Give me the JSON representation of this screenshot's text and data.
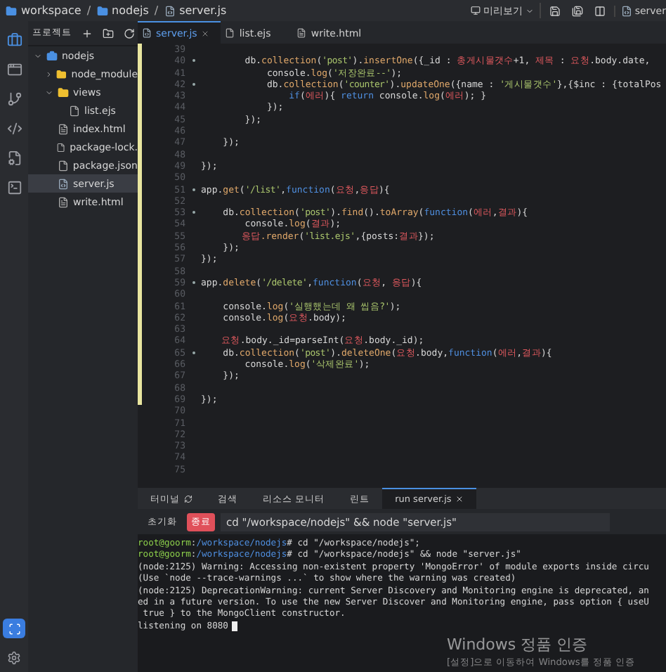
{
  "breadcrumb": [
    {
      "kind": "folder",
      "label": "workspace"
    },
    {
      "kind": "sep",
      "label": "/"
    },
    {
      "kind": "folder",
      "label": "nodejs"
    },
    {
      "kind": "sep",
      "label": "/"
    },
    {
      "kind": "file",
      "label": "server.js"
    }
  ],
  "toolbar": {
    "preview": "미리보기",
    "open_file": "server"
  },
  "activity_bar": [
    {
      "kind": "project",
      "selected": true
    },
    {
      "kind": "preview",
      "selected": false
    },
    {
      "kind": "git",
      "selected": false
    },
    {
      "kind": "code",
      "selected": false
    },
    {
      "kind": "config",
      "selected": false
    },
    {
      "kind": "vs",
      "selected": false
    }
  ],
  "file_tree": {
    "header": "프로젝트",
    "items": [
      {
        "label": "nodejs",
        "kind": "project",
        "expanded": true,
        "selected": false,
        "children": [
          {
            "label": "node_module",
            "kind": "folder",
            "expanded": false,
            "selected": false
          },
          {
            "label": "views",
            "kind": "folder",
            "expanded": true,
            "selected": false,
            "children": [
              {
                "label": "list.ejs",
                "kind": "file",
                "selected": false
              }
            ]
          },
          {
            "label": "index.html",
            "kind": "html",
            "selected": false
          },
          {
            "label": "package-lock.",
            "kind": "file",
            "selected": false
          },
          {
            "label": "package.json",
            "kind": "file",
            "selected": false
          },
          {
            "label": "server.js",
            "kind": "js",
            "selected": true
          },
          {
            "label": "write.html",
            "kind": "html",
            "selected": false
          }
        ]
      }
    ]
  },
  "editor": {
    "tabs": [
      {
        "label": "server.js",
        "kind": "js",
        "selected": true,
        "closable": true
      },
      {
        "label": "list.ejs",
        "kind": "file",
        "selected": false,
        "closable": false
      },
      {
        "label": "write.html",
        "kind": "html",
        "selected": false,
        "closable": false
      }
    ],
    "lines": [
      {
        "number": "39",
        "changed": true,
        "foldable": false
      },
      {
        "number": "40",
        "changed": true,
        "foldable": true,
        "code": [
          {
            "text": "        db.",
            "kind": "plain"
          },
          {
            "text": "collection",
            "kind": "method"
          },
          {
            "text": "(",
            "kind": "plain"
          },
          {
            "text": "'post'",
            "kind": "string"
          },
          {
            "text": ").",
            "kind": "plain"
          },
          {
            "text": "insertOne",
            "kind": "method"
          },
          {
            "text": "({_id : ",
            "kind": "plain"
          },
          {
            "text": "총게시물갯수",
            "kind": "hangul"
          },
          {
            "text": "+1, ",
            "kind": "plain"
          },
          {
            "text": "제목",
            "kind": "hangul"
          },
          {
            "text": " : ",
            "kind": "plain"
          },
          {
            "text": "요청",
            "kind": "hangul"
          },
          {
            "text": ".body.date,",
            "kind": "plain"
          }
        ]
      },
      {
        "number": "41",
        "changed": true,
        "foldable": false,
        "code": [
          {
            "text": "            console.",
            "kind": "plain"
          },
          {
            "text": "log",
            "kind": "method"
          },
          {
            "text": "(",
            "kind": "plain"
          },
          {
            "text": "'저장완료--'",
            "kind": "string"
          },
          {
            "text": ");",
            "kind": "plain"
          }
        ]
      },
      {
        "number": "42",
        "changed": true,
        "foldable": true,
        "code": [
          {
            "text": "            db.",
            "kind": "plain"
          },
          {
            "text": "collection",
            "kind": "method"
          },
          {
            "text": "(",
            "kind": "plain"
          },
          {
            "text": "'counter'",
            "kind": "string"
          },
          {
            "text": ").",
            "kind": "plain"
          },
          {
            "text": "updateOne",
            "kind": "method"
          },
          {
            "text": "({name : ",
            "kind": "plain"
          },
          {
            "text": "'게시물갯수'",
            "kind": "string"
          },
          {
            "text": "},{$inc : {totalPos",
            "kind": "plain"
          }
        ]
      },
      {
        "number": "43",
        "changed": true,
        "foldable": false,
        "code": [
          {
            "text": "                if",
            "kind": "keyword"
          },
          {
            "text": "(",
            "kind": "plain"
          },
          {
            "text": "에러",
            "kind": "hangul"
          },
          {
            "text": "){ ",
            "kind": "plain"
          },
          {
            "text": "return",
            "kind": "keyword"
          },
          {
            "text": " console.",
            "kind": "plain"
          },
          {
            "text": "log",
            "kind": "method"
          },
          {
            "text": "(",
            "kind": "plain"
          },
          {
            "text": "에러",
            "kind": "hangul"
          },
          {
            "text": "); }",
            "kind": "plain"
          }
        ]
      },
      {
        "number": "44",
        "changed": true,
        "foldable": false,
        "code": [
          {
            "text": "            });",
            "kind": "plain"
          }
        ]
      },
      {
        "number": "45",
        "changed": true,
        "foldable": false,
        "code": [
          {
            "text": "        });",
            "kind": "plain"
          }
        ]
      },
      {
        "number": "46",
        "changed": true,
        "foldable": false
      },
      {
        "number": "47",
        "changed": true,
        "foldable": false,
        "code": [
          {
            "text": "    });",
            "kind": "plain"
          }
        ]
      },
      {
        "number": "48",
        "changed": true,
        "foldable": false
      },
      {
        "number": "49",
        "changed": true,
        "foldable": false,
        "code": [
          {
            "text": "});",
            "kind": "plain"
          }
        ]
      },
      {
        "number": "50",
        "changed": true,
        "foldable": false
      },
      {
        "number": "51",
        "changed": true,
        "foldable": true,
        "code": [
          {
            "text": "app.",
            "kind": "plain"
          },
          {
            "text": "get",
            "kind": "method"
          },
          {
            "text": "(",
            "kind": "plain"
          },
          {
            "text": "'/list'",
            "kind": "string"
          },
          {
            "text": ",",
            "kind": "plain"
          },
          {
            "text": "function",
            "kind": "keyword"
          },
          {
            "text": "(",
            "kind": "plain"
          },
          {
            "text": "요청",
            "kind": "hangul"
          },
          {
            "text": ",",
            "kind": "plain"
          },
          {
            "text": "응답",
            "kind": "hangul"
          },
          {
            "text": "){",
            "kind": "plain"
          }
        ]
      },
      {
        "number": "52",
        "changed": true,
        "foldable": false
      },
      {
        "number": "53",
        "changed": true,
        "foldable": true,
        "code": [
          {
            "text": "    db.",
            "kind": "plain"
          },
          {
            "text": "collection",
            "kind": "method"
          },
          {
            "text": "(",
            "kind": "plain"
          },
          {
            "text": "'post'",
            "kind": "string"
          },
          {
            "text": ").",
            "kind": "plain"
          },
          {
            "text": "find",
            "kind": "method"
          },
          {
            "text": "().",
            "kind": "plain"
          },
          {
            "text": "toArray",
            "kind": "method"
          },
          {
            "text": "(",
            "kind": "plain"
          },
          {
            "text": "function",
            "kind": "keyword"
          },
          {
            "text": "(",
            "kind": "plain"
          },
          {
            "text": "에러",
            "kind": "hangul"
          },
          {
            "text": ",",
            "kind": "plain"
          },
          {
            "text": "결과",
            "kind": "hangul"
          },
          {
            "text": "){",
            "kind": "plain"
          }
        ]
      },
      {
        "number": "54",
        "changed": true,
        "foldable": false,
        "code": [
          {
            "text": "        console.",
            "kind": "plain"
          },
          {
            "text": "log",
            "kind": "method"
          },
          {
            "text": "(",
            "kind": "plain"
          },
          {
            "text": "결과",
            "kind": "hangul"
          },
          {
            "text": ");",
            "kind": "plain"
          }
        ]
      },
      {
        "number": "55",
        "changed": true,
        "foldable": false,
        "code": [
          {
            "text": "        응답",
            "kind": "hangul"
          },
          {
            "text": ".render",
            "kind": "method"
          },
          {
            "text": "(",
            "kind": "plain"
          },
          {
            "text": "'list.ejs'",
            "kind": "string"
          },
          {
            "text": ",{posts:",
            "kind": "plain"
          },
          {
            "text": "결과",
            "kind": "hangul"
          },
          {
            "text": "});",
            "kind": "plain"
          }
        ]
      },
      {
        "number": "56",
        "changed": true,
        "foldable": false,
        "code": [
          {
            "text": "    });",
            "kind": "plain"
          }
        ]
      },
      {
        "number": "57",
        "changed": true,
        "foldable": false,
        "code": [
          {
            "text": "});",
            "kind": "plain"
          }
        ]
      },
      {
        "number": "58",
        "changed": true,
        "foldable": false
      },
      {
        "number": "59",
        "changed": true,
        "foldable": true,
        "code": [
          {
            "text": "app.",
            "kind": "plain"
          },
          {
            "text": "delete",
            "kind": "method"
          },
          {
            "text": "(",
            "kind": "plain"
          },
          {
            "text": "'/delete'",
            "kind": "string"
          },
          {
            "text": ",",
            "kind": "plain"
          },
          {
            "text": "function",
            "kind": "keyword"
          },
          {
            "text": "(",
            "kind": "plain"
          },
          {
            "text": "요청",
            "kind": "hangul"
          },
          {
            "text": ", ",
            "kind": "plain"
          },
          {
            "text": "응답",
            "kind": "hangul"
          },
          {
            "text": "){",
            "kind": "plain"
          }
        ]
      },
      {
        "number": "60",
        "changed": true,
        "foldable": false
      },
      {
        "number": "61",
        "changed": true,
        "foldable": false,
        "code": [
          {
            "text": "    console.",
            "kind": "plain"
          },
          {
            "text": "log",
            "kind": "method"
          },
          {
            "text": "(",
            "kind": "plain"
          },
          {
            "text": "'실행했는데 왜 씹음?'",
            "kind": "string"
          },
          {
            "text": ");",
            "kind": "plain"
          }
        ]
      },
      {
        "number": "62",
        "changed": true,
        "foldable": false,
        "code": [
          {
            "text": "    console.",
            "kind": "plain"
          },
          {
            "text": "log",
            "kind": "method"
          },
          {
            "text": "(",
            "kind": "plain"
          },
          {
            "text": "요청",
            "kind": "hangul"
          },
          {
            "text": ".body);",
            "kind": "plain"
          }
        ]
      },
      {
        "number": "63",
        "changed": true,
        "foldable": false
      },
      {
        "number": "64",
        "changed": true,
        "foldable": false,
        "code": [
          {
            "text": "    요청",
            "kind": "hangul"
          },
          {
            "text": ".body._id=parseInt(",
            "kind": "plain"
          },
          {
            "text": "요청",
            "kind": "hangul"
          },
          {
            "text": ".body._id);",
            "kind": "plain"
          }
        ]
      },
      {
        "number": "65",
        "changed": true,
        "foldable": true,
        "code": [
          {
            "text": "    db.",
            "kind": "plain"
          },
          {
            "text": "collection",
            "kind": "method"
          },
          {
            "text": "(",
            "kind": "plain"
          },
          {
            "text": "'post'",
            "kind": "string"
          },
          {
            "text": ").",
            "kind": "plain"
          },
          {
            "text": "deleteOne",
            "kind": "method"
          },
          {
            "text": "(",
            "kind": "plain"
          },
          {
            "text": "요청",
            "kind": "hangul"
          },
          {
            "text": ".body,",
            "kind": "plain"
          },
          {
            "text": "function",
            "kind": "keyword"
          },
          {
            "text": "(",
            "kind": "plain"
          },
          {
            "text": "에러",
            "kind": "hangul"
          },
          {
            "text": ",",
            "kind": "plain"
          },
          {
            "text": "결과",
            "kind": "hangul"
          },
          {
            "text": "){",
            "kind": "plain"
          }
        ]
      },
      {
        "number": "66",
        "changed": true,
        "foldable": false,
        "code": [
          {
            "text": "        console.",
            "kind": "plain"
          },
          {
            "text": "log",
            "kind": "method"
          },
          {
            "text": "(",
            "kind": "plain"
          },
          {
            "text": "'삭제완료'",
            "kind": "string"
          },
          {
            "text": ");",
            "kind": "plain"
          }
        ]
      },
      {
        "number": "67",
        "changed": true,
        "foldable": false,
        "code": [
          {
            "text": "    });",
            "kind": "plain"
          }
        ]
      },
      {
        "number": "68",
        "changed": true,
        "foldable": false
      },
      {
        "number": "69",
        "changed": true,
        "foldable": false,
        "code": [
          {
            "text": "});",
            "kind": "plain"
          }
        ]
      },
      {
        "number": "70",
        "changed": false,
        "foldable": false
      },
      {
        "number": "71",
        "changed": false,
        "foldable": false
      },
      {
        "number": "72",
        "changed": false,
        "foldable": false
      },
      {
        "number": "73",
        "changed": false,
        "foldable": false
      },
      {
        "number": "74",
        "changed": false,
        "foldable": false
      },
      {
        "number": "75",
        "changed": false,
        "foldable": false
      }
    ]
  },
  "terminal": {
    "tabs": [
      {
        "label": "터미널",
        "kind": "terminal",
        "selected": false,
        "closable": false
      },
      {
        "label": "검색",
        "kind": "plain",
        "selected": false,
        "closable": false
      },
      {
        "label": "리소스 모니터",
        "kind": "plain",
        "selected": false,
        "closable": false
      },
      {
        "label": "린트",
        "kind": "plain",
        "selected": false,
        "closable": false
      },
      {
        "label": "run server.js",
        "kind": "plain",
        "selected": true,
        "closable": true
      }
    ],
    "reset_button": "초기화",
    "stop_button": "종료",
    "command": "cd \"/workspace/nodejs\" && node \"server.js\"",
    "output": [
      [
        {
          "text": "root@goorm",
          "kind": "user"
        },
        {
          "text": ":",
          "kind": "plain"
        },
        {
          "text": "/workspace/nodejs",
          "kind": "path"
        },
        {
          "text": "# cd \"/workspace/nodejs\";",
          "kind": "plain"
        }
      ],
      [
        {
          "text": "root@goorm",
          "kind": "user"
        },
        {
          "text": ":",
          "kind": "plain"
        },
        {
          "text": "/workspace/nodejs",
          "kind": "path"
        },
        {
          "text": "# cd \"/workspace/nodejs\" && node \"server.js\"",
          "kind": "plain"
        }
      ],
      [
        {
          "text": "(node:2125) Warning: Accessing non-existent property 'MongoError' of module exports inside circu",
          "kind": "plain"
        }
      ],
      [
        {
          "text": "(Use `node --trace-warnings ...` to show where the warning was created)",
          "kind": "plain"
        }
      ],
      [
        {
          "text": "(node:2125) DeprecationWarning: current Server Discovery and Monitoring engine is deprecated, an",
          "kind": "plain"
        }
      ],
      [
        {
          "text": "ed in a future version. To use the new Server Discover and Monitoring engine, pass option { useU",
          "kind": "plain"
        }
      ],
      [
        {
          "text": " true } to the MongoClient constructor.",
          "kind": "plain"
        }
      ],
      [
        {
          "text": "listening on 8080",
          "kind": "plain"
        }
      ]
    ],
    "cursor": true
  },
  "os_overlay": {
    "title": "Windows 정품 인증",
    "message": "[설정]으로 이동하여 Windows를 정품 인증"
  }
}
